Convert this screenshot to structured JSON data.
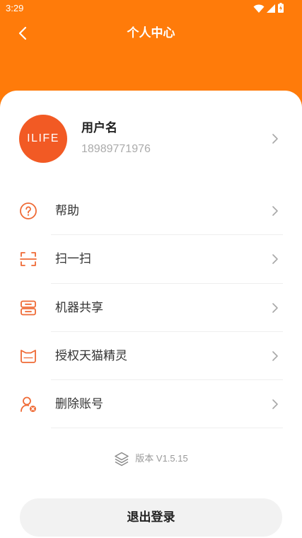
{
  "status_bar": {
    "time": "3:29",
    "icons": [
      "wifi-icon",
      "cellular-signal-icon",
      "battery-charging-icon"
    ]
  },
  "header": {
    "title": "个人中心",
    "back_icon": "chevron-left-icon"
  },
  "profile": {
    "avatar_text": "ILIFE",
    "username": "用户名",
    "phone": "18989771976"
  },
  "menu": [
    {
      "label": "帮助",
      "icon": "help-icon"
    },
    {
      "label": "扫一扫",
      "icon": "scan-icon"
    },
    {
      "label": "机器共享",
      "icon": "device-share-icon"
    },
    {
      "label": "授权天猫精灵",
      "icon": "tmall-genie-icon"
    },
    {
      "label": "删除账号",
      "icon": "delete-account-icon"
    }
  ],
  "version": {
    "text": "版本 V1.5.15",
    "icon": "layers-icon"
  },
  "logout": {
    "label": "退出登录"
  },
  "colors": {
    "accent": "#FF7B0A",
    "avatar": "#F25A24",
    "icon": "#EF6A35",
    "text": "#333333",
    "muted": "#ABABAB",
    "button_bg": "#F2F2F2"
  }
}
